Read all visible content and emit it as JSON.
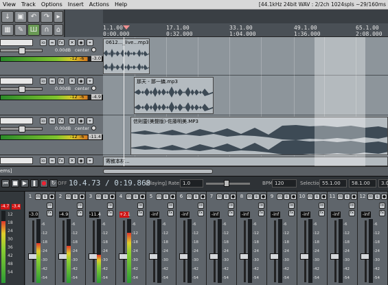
{
  "menu": {
    "items": [
      "View",
      "Track",
      "Options",
      "Insert",
      "Actions",
      "Help"
    ],
    "status": "[44.1kHz 24bit WAV : 2/2ch 1024spls ~29/160ms"
  },
  "toolbar": {
    "icons": [
      "open-icon",
      "save-icon",
      "undo-icon",
      "redo-icon",
      "grid-icon",
      "wrench-icon",
      "metronome-icon",
      "magnet-icon",
      "lock-icon"
    ]
  },
  "ruler": {
    "marks": [
      {
        "bar": "1.1.00",
        "time": "0:00.000"
      },
      {
        "bar": "17.1.00",
        "time": "0:32.000"
      },
      {
        "bar": "33.1.00",
        "time": "1:04.000"
      },
      {
        "bar": "49.1.00",
        "time": "1:36.000"
      },
      {
        "bar": "65.1.00",
        "time": "2:08.000"
      }
    ]
  },
  "tracks": [
    {
      "name": "",
      "volume_db": "0.00dB",
      "pan": "center",
      "meter_ticks": [
        "-12",
        "-6"
      ],
      "meter_peak": "-3.0"
    },
    {
      "name": "",
      "volume_db": "0.00dB",
      "pan": "center",
      "meter_ticks": [
        "-12",
        "-6"
      ],
      "meter_peak": "-4.9"
    },
    {
      "name": "",
      "volume_db": "0.00dB",
      "pan": "center",
      "meter_ticks": [
        "-12",
        "-6"
      ],
      "meter_peak": "-11.4"
    },
    {
      "name": "",
      "volume_db": "0.00dB",
      "pan": "center",
      "meter_ticks": [
        "-12",
        "-6"
      ],
      "meter_peak": "+2.1"
    }
  ],
  "items": [
    {
      "title": "0612..._live...mp3"
    },
    {
      "title": "那天 - 那一鎮.mp3"
    },
    {
      "title": "信則靈(美聲版)-佐藤明美.MP3"
    },
    {
      "title": "寄敘本材..."
    }
  ],
  "scroll_label": "ems]",
  "transport": {
    "time": "10.4.73 / 0:19.868",
    "state": "[Playing]",
    "rate_label": "Rate:",
    "rate_value": "1.0",
    "bpm_label": "BPM:",
    "bpm_value": "120",
    "selection_label": "Selection:",
    "selection_start": "55.1.00",
    "selection_end": "58.1.00",
    "selection_len": "3.0.00",
    "offs_label": "OFF"
  },
  "master": {
    "peak_l": "-4.7",
    "peak_r": "-3.4",
    "scale": [
      "12",
      "18",
      "24",
      "30",
      "36",
      "42",
      "48",
      "54",
      "60"
    ]
  },
  "mixer": {
    "scale": [
      "-6",
      "-12",
      "-18",
      "-24",
      "-30",
      "-42",
      "-54"
    ],
    "strips": [
      {
        "num": "1",
        "peak": "-3.0",
        "clip": false,
        "level": 0.62
      },
      {
        "num": "2",
        "peak": "-4.9",
        "clip": false,
        "level": 0.58
      },
      {
        "num": "3",
        "peak": "-11.4",
        "clip": false,
        "level": 0.44
      },
      {
        "num": "4",
        "peak": "+2.1",
        "clip": true,
        "level": 0.78
      },
      {
        "num": "5",
        "peak": "-inf",
        "clip": false,
        "level": 0
      },
      {
        "num": "6",
        "peak": "-inf",
        "clip": false,
        "level": 0
      },
      {
        "num": "7",
        "peak": "-inf",
        "clip": false,
        "level": 0
      },
      {
        "num": "8",
        "peak": "-inf",
        "clip": false,
        "level": 0
      },
      {
        "num": "9",
        "peak": "-inf",
        "clip": false,
        "level": 0
      },
      {
        "num": "10",
        "peak": "-inf",
        "clip": false,
        "level": 0
      },
      {
        "num": "11",
        "peak": "-inf",
        "clip": false,
        "level": 0
      },
      {
        "num": "12",
        "peak": "-inf",
        "clip": false,
        "level": 0
      }
    ]
  },
  "colors": {
    "clip": "#d01515",
    "meter_green": "#2c9a35",
    "selection": "#ffffff"
  }
}
